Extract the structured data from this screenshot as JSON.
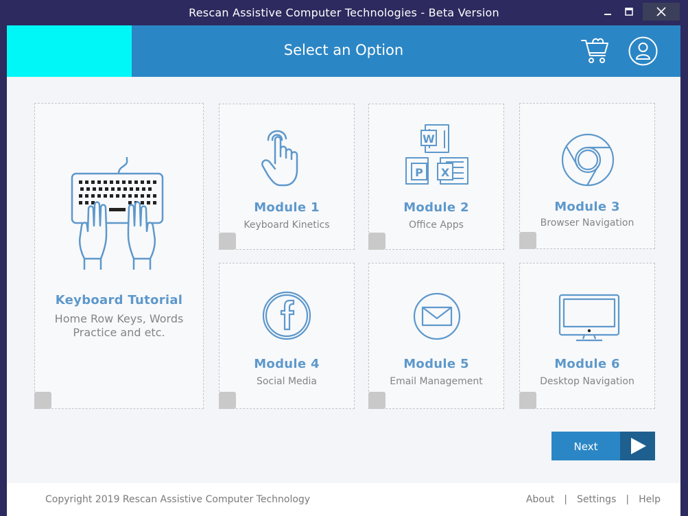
{
  "window": {
    "title": "Rescan Assistive Computer Technologies - Beta Version"
  },
  "header": {
    "title": "Select an Option",
    "icons": {
      "cart": "cart-icon",
      "user": "user-icon"
    }
  },
  "tutorial": {
    "title": "Keyboard Tutorial",
    "subtitle": "Home Row Keys, Words Practice and etc.",
    "icon": "keyboard-hands-icon"
  },
  "modules": [
    {
      "title": "Module 1",
      "subtitle": "Keyboard Kinetics",
      "icon": "pointer-hand-icon"
    },
    {
      "title": "Module 2",
      "subtitle": "Office Apps",
      "icon": "office-apps-icon"
    },
    {
      "title": "Module 3",
      "subtitle": "Browser Navigation",
      "icon": "chrome-icon"
    },
    {
      "title": "Module 4",
      "subtitle": "Social Media",
      "icon": "facebook-icon"
    },
    {
      "title": "Module 5",
      "subtitle": "Email Management",
      "icon": "mail-icon"
    },
    {
      "title": "Module 6",
      "subtitle": "Desktop Navigation",
      "icon": "monitor-icon"
    }
  ],
  "actions": {
    "next_label": "Next"
  },
  "footer": {
    "copyright": "Copyright 2019 Rescan Assistive Computer Technology",
    "links": [
      "About",
      "Settings",
      "Help"
    ],
    "separator": "|"
  },
  "colors": {
    "accent": "#2b86c5",
    "accent_dark": "#1d5f8f",
    "logo_placeholder": "#00f7f7",
    "module_title": "#5d98cb",
    "window_frame": "#2c2a5e"
  }
}
